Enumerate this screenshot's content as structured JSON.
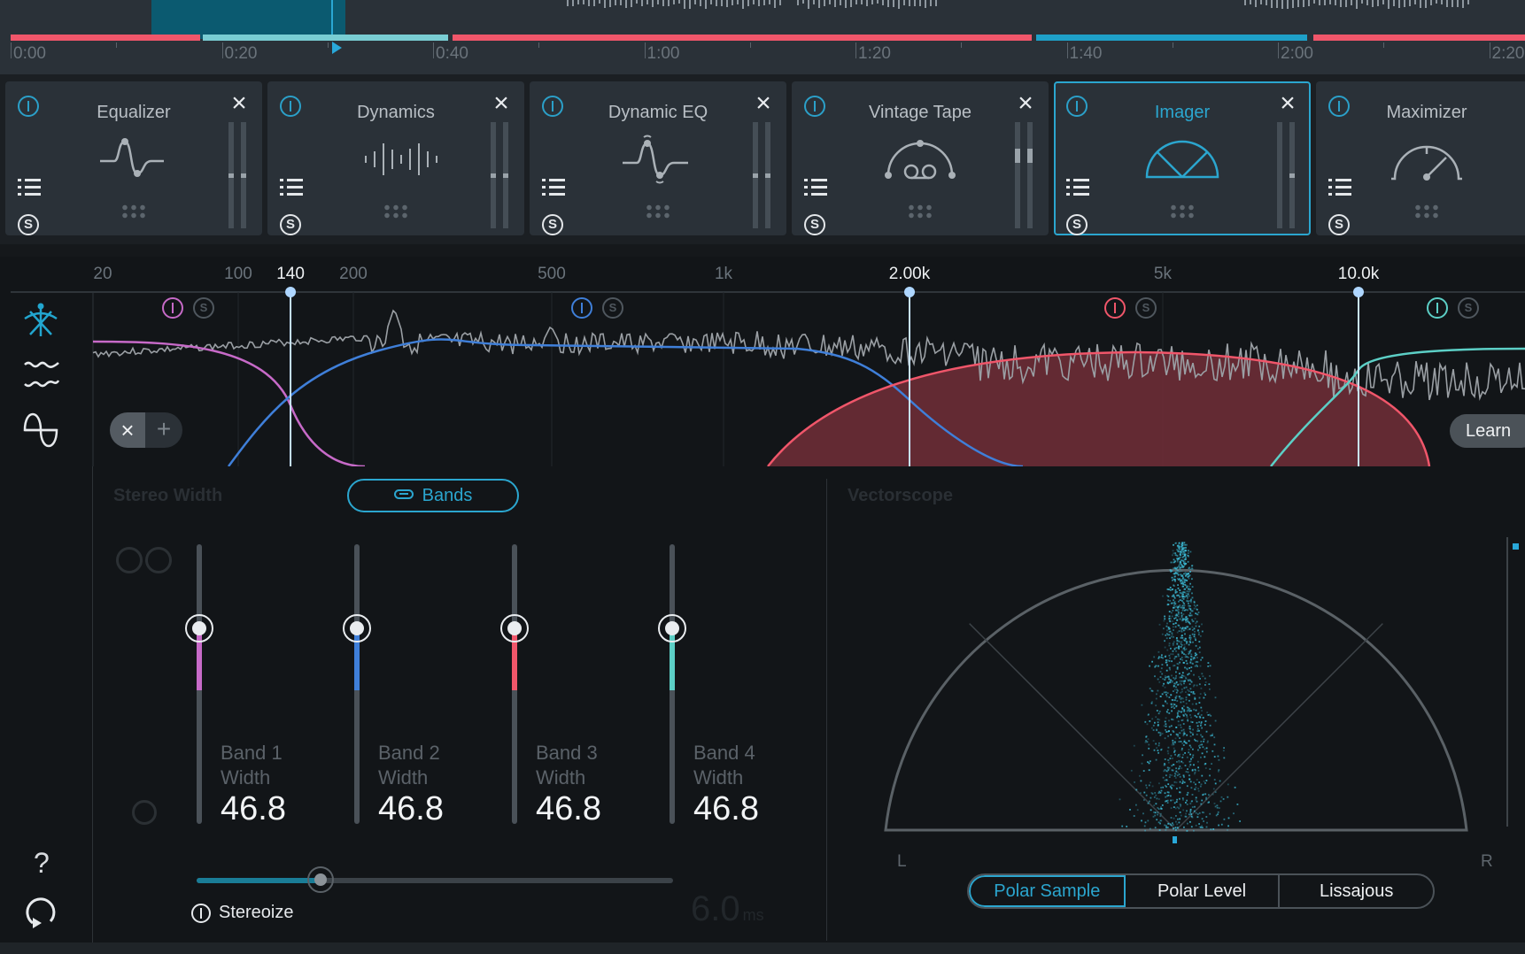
{
  "timeline": {
    "labels": [
      "0:00",
      "0:20",
      "0:40",
      "1:00",
      "1:20",
      "1:40",
      "2:00",
      "2:20"
    ],
    "segments": [
      {
        "start": 0.0,
        "end": 0.125,
        "color": "#f0566a"
      },
      {
        "start": 0.127,
        "end": 0.289,
        "color": "#79cdd3"
      },
      {
        "start": 0.292,
        "end": 0.674,
        "color": "#f0566a"
      },
      {
        "start": 0.677,
        "end": 0.856,
        "color": "#1ea0c8"
      },
      {
        "start": 0.86,
        "end": 1.0,
        "color": "#f0566a"
      }
    ]
  },
  "modules": [
    {
      "title": "Equalizer",
      "glyph": "eq-icon",
      "selected": false,
      "close": "×",
      "solo": "S"
    },
    {
      "title": "Dynamics",
      "glyph": "dynamics-icon",
      "selected": false,
      "close": "×",
      "solo": "S"
    },
    {
      "title": "Dynamic EQ",
      "glyph": "dynamic-eq-icon",
      "selected": false,
      "close": "×",
      "solo": "S"
    },
    {
      "title": "Vintage Tape",
      "glyph": "tape-icon",
      "selected": false,
      "close": "×",
      "solo": "S"
    },
    {
      "title": "Imager",
      "glyph": "imager-icon",
      "selected": true,
      "close": "×",
      "solo": "S"
    },
    {
      "title": "Maximizer",
      "glyph": "maximizer-icon",
      "selected": false,
      "close": "",
      "solo": "S"
    }
  ],
  "spectrum": {
    "freq_labels": [
      {
        "text": "20",
        "active": false
      },
      {
        "text": "100",
        "active": false
      },
      {
        "text": "140",
        "active": true
      },
      {
        "text": "200",
        "active": false
      },
      {
        "text": "500",
        "active": false
      },
      {
        "text": "1k",
        "active": false
      },
      {
        "text": "2.00k",
        "active": true
      },
      {
        "text": "5k",
        "active": false
      },
      {
        "text": "10.0k",
        "active": true
      }
    ],
    "crossovers_hz": [
      140,
      2000,
      10000
    ],
    "bands": [
      {
        "name": "Band 1",
        "color": "#c76ac8"
      },
      {
        "name": "Band 2",
        "color": "#3f7fd9"
      },
      {
        "name": "Band 3",
        "color": "#f0566a"
      },
      {
        "name": "Band 4",
        "color": "#5ccfc6"
      }
    ],
    "band_power_label": "I",
    "band_solo_label": "S",
    "remove_band": "×",
    "add_band": "+",
    "learn_label": "Learn",
    "side_tools": [
      "stereo-spread-icon",
      "waveform-icon",
      "phase-icon"
    ]
  },
  "stereo_width": {
    "title": "Stereo Width",
    "bands_button": "Bands",
    "bands": [
      {
        "label_line1": "Band 1",
        "label_line2": "Width",
        "value": "46.8",
        "level": 0.468,
        "color": "#c76ac8"
      },
      {
        "label_line1": "Band 2",
        "label_line2": "Width",
        "value": "46.8",
        "level": 0.468,
        "color": "#3f7fd9"
      },
      {
        "label_line1": "Band 3",
        "label_line2": "Width",
        "value": "46.8",
        "level": 0.468,
        "color": "#f0566a"
      },
      {
        "label_line1": "Band 4",
        "label_line2": "Width",
        "value": "46.8",
        "level": 0.468,
        "color": "#5ccfc6"
      }
    ],
    "stereoize_label": "Stereoize",
    "stereoize_level": 0.26,
    "delay_value": "6.0",
    "delay_unit": "ms"
  },
  "vectorscope": {
    "title": "Vectorscope",
    "left_label": "L",
    "right_label": "R",
    "tabs": [
      {
        "label": "Polar Sample",
        "active": true
      },
      {
        "label": "Polar Level",
        "active": false
      },
      {
        "label": "Lissajous",
        "active": false
      }
    ]
  },
  "sidebar": {
    "help_label": "?"
  },
  "colors": {
    "accent": "#2ba6cf",
    "band3_fill": "#6d2c36"
  }
}
